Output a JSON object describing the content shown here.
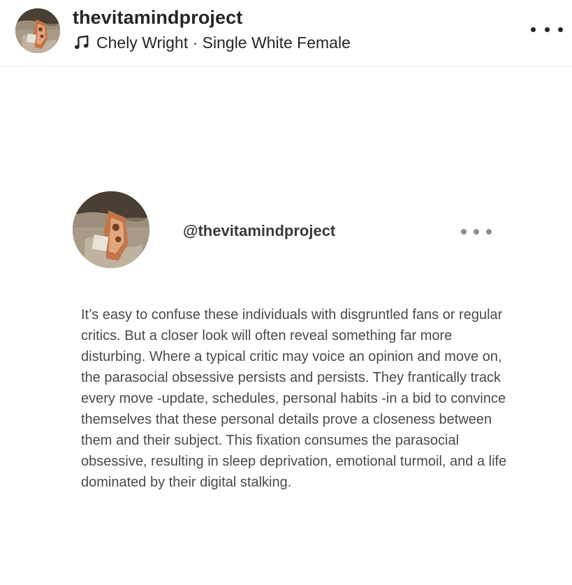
{
  "header": {
    "username": "thevitamindproject",
    "audio": {
      "icon": "music-note-icon",
      "text": "Chely Wright · Single White Female"
    },
    "more_icon": "more-horizontal-icon"
  },
  "post": {
    "handle": "@thevitamindproject",
    "more_icon": "more-horizontal-icon",
    "body": "It’s easy to confuse these individuals with disgruntled fans or regular critics. But a closer look will often reveal something far more disturbing. Where a typical critic may voice an opinion and move on, the parasocial obsessive persists and persists. They frantically track every move -update, schedules, personal habits -in a bid to convince themselves that these personal details prove a closeness between them and their subject. This fixation consumes the parasocial obsessive, resulting in sleep deprivation, emotional turmoil, and a life dominated by their digital stalking."
  }
}
